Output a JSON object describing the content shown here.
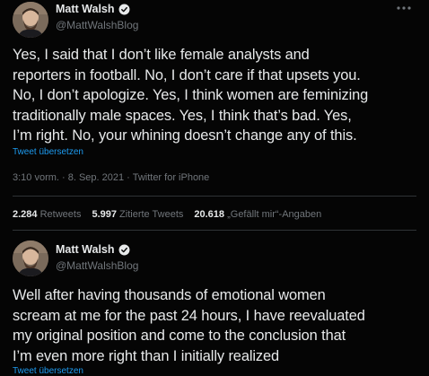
{
  "tweets": [
    {
      "display_name": "Matt Walsh",
      "handle": "@MattWalshBlog",
      "lines": [
        "Yes, I said that I don’t like female analysts and",
        "reporters in football. No, I don’t care if that upsets you.",
        "No, I don’t apologize. Yes, I think women are feminizing",
        "traditionally male spaces. Yes, I think that’s bad. Yes,",
        "I’m right. No, your whining doesn’t change any of this."
      ],
      "translate_label": "Tweet übersetzen",
      "timestamp": "3:10 vorm. · 8. Sep. 2021 · Twitter for iPhone",
      "stats": {
        "retweets_count": "2.284",
        "retweets_label": "Retweets",
        "quotes_count": "5.997",
        "quotes_label": "Zitierte Tweets",
        "likes_count": "20.618",
        "likes_label": "„Gefällt mir“-Angaben"
      }
    },
    {
      "display_name": "Matt Walsh",
      "handle": "@MattWalshBlog",
      "lines": [
        "Well after having thousands of emotional women",
        "scream at me for the past 24 hours, I have reevaluated",
        "my original position and come to the conclusion that",
        "I’m even more right than I initially realized"
      ],
      "translate_label": "Tweet übersetzen"
    }
  ],
  "icons": {
    "verified": "verified-badge-icon",
    "more": "more-options-icon"
  },
  "colors": {
    "background": "#050505",
    "text": "#e7e9ea",
    "secondary": "#71767b",
    "link": "#1d9bf0"
  }
}
